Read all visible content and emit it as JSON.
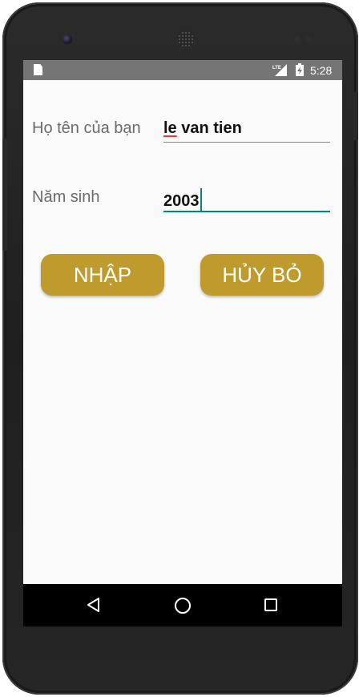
{
  "status_bar": {
    "time": "5:28",
    "network_label": "LTE",
    "icons": [
      "sd-card-icon",
      "lte-signal-icon",
      "battery-charging-icon"
    ]
  },
  "form": {
    "name_label": "Họ tên của bạn",
    "name_value_first": "le",
    "name_value_rest": " van tien",
    "year_label": "Năm sinh",
    "year_value": "2003"
  },
  "buttons": {
    "submit_label": "NHẬP",
    "cancel_label": "HỦY BỎ"
  },
  "nav_bar": {
    "icons": [
      "back-icon",
      "home-icon",
      "recents-icon"
    ]
  },
  "colors": {
    "accent": "#00897b",
    "button": "#bf9a2c",
    "status_bar": "#757575",
    "spellcheck": "#e53935"
  }
}
